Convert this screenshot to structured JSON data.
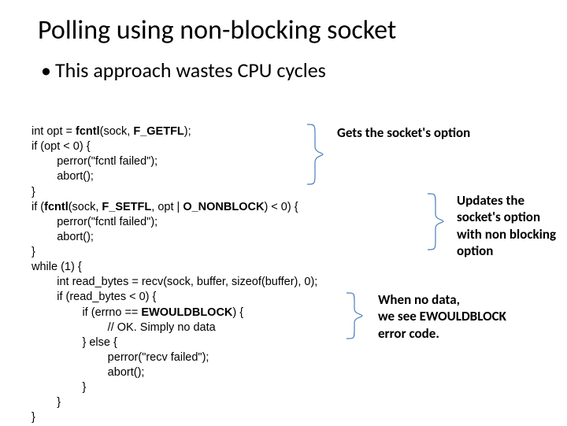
{
  "title": "Polling using non-blocking socket",
  "bullet": "This approach wastes CPU cycles",
  "code": {
    "l1a": "int opt = ",
    "l1b": "fcntl",
    "l1c": "(sock, ",
    "l1d": "F_GETFL",
    "l1e": ");",
    "l2": "if (opt < 0) {",
    "l3": "        perror(\"fcntl failed\");",
    "l4": "        abort();",
    "l5": "}",
    "l6a": "if (",
    "l6b": "fcntl",
    "l6c": "(sock, ",
    "l6d": "F_SETFL",
    "l6e": ", opt | ",
    "l6f": "O_NONBLOCK",
    "l6g": ") < 0) {",
    "l7": "        perror(\"fcntl failed\");",
    "l8": "        abort();",
    "l9": "}",
    "l10": "while (1) {",
    "l11": "        int read_bytes = recv(sock, buffer, sizeof(buffer), 0);",
    "l12": "        if (read_bytes < 0) {",
    "l13a": "                if (errno == ",
    "l13b": "EWOULDBLOCK",
    "l13c": ") {",
    "l14": "                        // OK. Simply no data",
    "l15": "                } else {",
    "l16": "                        perror(\"recv failed\");",
    "l17": "                        abort();",
    "l18": "                }",
    "l19": "        }",
    "l20": "}"
  },
  "annotations": {
    "a1": "Gets the socket's option",
    "a2": "Updates the socket's option with non blocking option",
    "a3": "When no data,\nwe see EWOULDBLOCK error code."
  }
}
